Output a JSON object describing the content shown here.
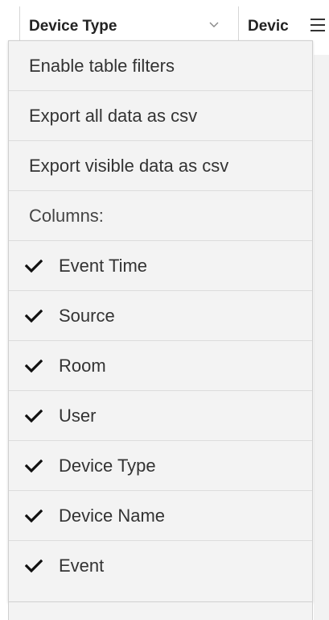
{
  "header": {
    "column_device_type": "Device Type",
    "column_device_name": "Devic",
    "sort_icon": "chevron-down-icon",
    "menu_icon": "hamburger-menu-icon"
  },
  "menu": {
    "actions": [
      {
        "label": "Enable table filters"
      },
      {
        "label": "Export all data as csv"
      },
      {
        "label": "Export visible data as csv"
      }
    ],
    "columns_label": "Columns:",
    "check_icon": "checkmark-icon",
    "columns": [
      {
        "label": "Event Time",
        "checked": true
      },
      {
        "label": "Source",
        "checked": true
      },
      {
        "label": "Room",
        "checked": true
      },
      {
        "label": "User",
        "checked": true
      },
      {
        "label": "Device Type",
        "checked": true
      },
      {
        "label": "Device Name",
        "checked": true
      },
      {
        "label": "Event",
        "checked": true
      }
    ]
  },
  "colors": {
    "menu_bg": "#f3f3f3",
    "menu_border": "#d0d0d0",
    "text": "#333333"
  }
}
